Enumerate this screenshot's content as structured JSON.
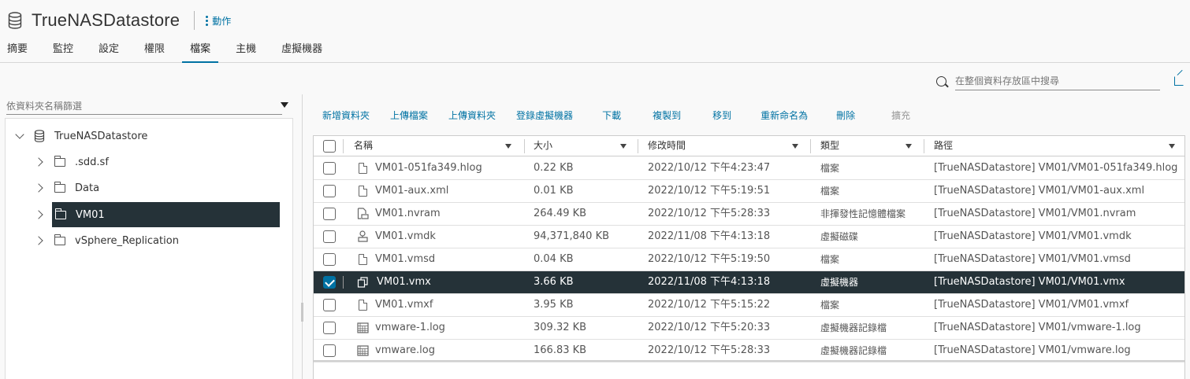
{
  "header": {
    "title": "TrueNASDatastore",
    "actions_label": "動作"
  },
  "tabs": [
    {
      "label": "摘要"
    },
    {
      "label": "監控"
    },
    {
      "label": "設定"
    },
    {
      "label": "權限"
    },
    {
      "label": "檔案",
      "active": true
    },
    {
      "label": "主機"
    },
    {
      "label": "虛擬機器"
    }
  ],
  "left": {
    "filter_placeholder": "依資料夾名稱篩選",
    "tree": {
      "root": "TrueNASDatastore",
      "children": [
        {
          "label": ".sdd.sf"
        },
        {
          "label": "Data"
        },
        {
          "label": "VM01",
          "selected": true
        },
        {
          "label": "vSphere_Replication"
        }
      ]
    }
  },
  "search": {
    "placeholder": "在整個資料存放區中搜尋"
  },
  "toolbar": [
    {
      "label": "新增資料夾"
    },
    {
      "label": "上傳檔案"
    },
    {
      "label": "上傳資料夾"
    },
    {
      "label": "登錄虛擬機器"
    },
    {
      "label": "下載"
    },
    {
      "label": "複製到"
    },
    {
      "label": "移到"
    },
    {
      "label": "重新命名為"
    },
    {
      "label": "刪除"
    },
    {
      "label": "擴充",
      "disabled": true
    }
  ],
  "grid": {
    "columns": [
      "名稱",
      "大小",
      "修改時間",
      "類型",
      "路徑"
    ],
    "rows": [
      {
        "name": "VM01-051fa349.hlog",
        "size": "0.22 KB",
        "modified": "2022/10/12 下午4:23:47",
        "type": "檔案",
        "path": "[TrueNASDatastore] VM01/VM01-051fa349.hlog",
        "icon": "file-icon"
      },
      {
        "name": "VM01-aux.xml",
        "size": "0.01 KB",
        "modified": "2022/10/12 下午5:19:51",
        "type": "檔案",
        "path": "[TrueNASDatastore] VM01/VM01-aux.xml",
        "icon": "file-icon"
      },
      {
        "name": "VM01.nvram",
        "size": "264.49 KB",
        "modified": "2022/10/12 下午5:28:33",
        "type": "非揮發性記憶體檔案",
        "path": "[TrueNASDatastore] VM01/VM01.nvram",
        "icon": "nvram-file-icon"
      },
      {
        "name": "VM01.vmdk",
        "size": "94,371,840 KB",
        "modified": "2022/11/08 下午4:13:18",
        "type": "虛擬磁碟",
        "path": "[TrueNASDatastore] VM01/VM01.vmdk",
        "icon": "disk-file-icon"
      },
      {
        "name": "VM01.vmsd",
        "size": "0.04 KB",
        "modified": "2022/10/12 下午5:19:50",
        "type": "檔案",
        "path": "[TrueNASDatastore] VM01/VM01.vmsd",
        "icon": "file-icon"
      },
      {
        "name": "VM01.vmx",
        "size": "3.66 KB",
        "modified": "2022/11/08 下午4:13:18",
        "type": "虛擬機器",
        "path": "[TrueNASDatastore] VM01/VM01.vmx",
        "icon": "vm-file-icon",
        "selected": true
      },
      {
        "name": "VM01.vmxf",
        "size": "3.95 KB",
        "modified": "2022/10/12 下午5:15:22",
        "type": "檔案",
        "path": "[TrueNASDatastore] VM01/VM01.vmxf",
        "icon": "file-icon"
      },
      {
        "name": "vmware-1.log",
        "size": "309.32 KB",
        "modified": "2022/10/12 下午5:20:33",
        "type": "虛擬機器記錄檔",
        "path": "[TrueNASDatastore] VM01/vmware-1.log",
        "icon": "log-file-icon"
      },
      {
        "name": "vmware.log",
        "size": "166.83 KB",
        "modified": "2022/10/12 下午5:28:33",
        "type": "虛擬機器記錄檔",
        "path": "[TrueNASDatastore] VM01/vmware.log",
        "icon": "log-file-icon"
      }
    ]
  },
  "colors": {
    "accent": "#0072a3",
    "selected_bg": "#253238"
  }
}
